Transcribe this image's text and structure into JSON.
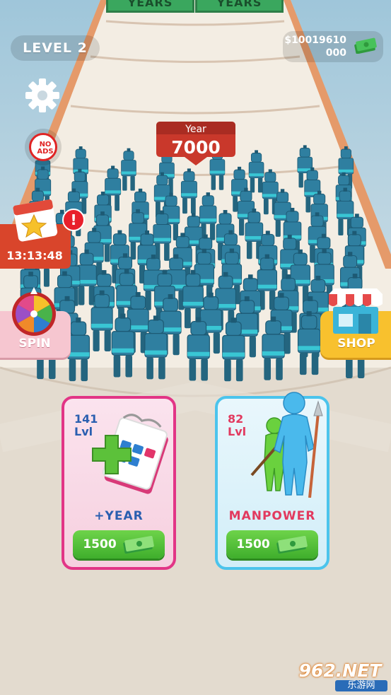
{
  "hud": {
    "level": "LEVEL 2",
    "money_line1": "$10019610",
    "money_line2": "000",
    "money_icon": "cash-stack-icon"
  },
  "gates": [
    "YEARS",
    "YEARS"
  ],
  "settings_icon": "gear-icon",
  "no_ads": {
    "text": "NO\nADS",
    "icon": "no-ads-icon"
  },
  "year_counter": {
    "label": "Year",
    "value": "7000"
  },
  "daily_calendar": {
    "icon": "calendar-star-icon",
    "timer": "13:13:48",
    "alert": "!"
  },
  "spin": {
    "label": "SPIN",
    "icon": "prize-wheel-icon"
  },
  "shop": {
    "label": "SHOP",
    "icon": "shop-icon"
  },
  "upgrades": [
    {
      "level_num": "141",
      "level_unit": "Lvl",
      "title": "+YEAR",
      "price": "1500",
      "icon": "calendar-plus-icon"
    },
    {
      "level_num": "82",
      "level_unit": "Lvl",
      "title": "MANPOWER",
      "price": "1500",
      "icon": "stickmen-spear-icon"
    }
  ],
  "watermark": {
    "text": "962.NET",
    "sub": "乐游网"
  },
  "colors": {
    "crowd": "#2f7fa0",
    "year_badge": "#c9382b",
    "buy_button": "#4cbf33"
  }
}
